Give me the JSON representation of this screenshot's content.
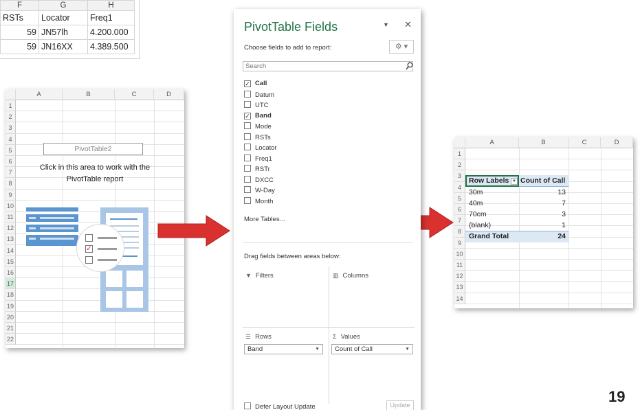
{
  "fragment": {
    "columns": [
      "F",
      "G",
      "H"
    ],
    "header": [
      "RSTs",
      "Locator",
      "Freq1"
    ],
    "rows": [
      [
        "59",
        "JN57lh",
        "4.200.000"
      ],
      [
        "59",
        "JN16XX",
        "4.389.500"
      ]
    ]
  },
  "sheet1": {
    "columns": [
      "A",
      "B",
      "C",
      "D"
    ],
    "rows": [
      "1",
      "2",
      "3",
      "4",
      "5",
      "6",
      "7",
      "8",
      "9",
      "10",
      "11",
      "12",
      "13",
      "14",
      "15",
      "16",
      "17",
      "18",
      "19",
      "20",
      "21",
      "22"
    ],
    "active_row": "17",
    "placeholder_name": "PivotTable2",
    "hint": "Click in this area to work with the PivotTable report"
  },
  "pane": {
    "title": "PivotTable Fields",
    "choose_label": "Choose fields to add to report:",
    "search_placeholder": "Search",
    "fields": [
      {
        "label": "Call",
        "checked": true
      },
      {
        "label": "Datum",
        "checked": false
      },
      {
        "label": "UTC",
        "checked": false
      },
      {
        "label": "Band",
        "checked": true
      },
      {
        "label": "Mode",
        "checked": false
      },
      {
        "label": "RSTs",
        "checked": false
      },
      {
        "label": "Locator",
        "checked": false
      },
      {
        "label": "Freq1",
        "checked": false
      },
      {
        "label": "RSTr",
        "checked": false
      },
      {
        "label": "DXCC",
        "checked": false
      },
      {
        "label": "W-Day",
        "checked": false
      },
      {
        "label": "Month",
        "checked": false
      }
    ],
    "more_tables": "More Tables...",
    "drag_hint": "Drag fields between areas below:",
    "areas": {
      "filters": "Filters",
      "columns": "Columns",
      "rows": "Rows",
      "values": "Values",
      "rows_value": "Band",
      "values_value": "Count of Call"
    },
    "defer_label": "Defer Layout Update",
    "update_label": "Update"
  },
  "sheet2": {
    "columns": [
      "A",
      "B",
      "C",
      "D"
    ],
    "rows": [
      "1",
      "2",
      "3",
      "4",
      "5",
      "6",
      "7",
      "8",
      "9",
      "10",
      "11",
      "12",
      "13",
      "14"
    ],
    "header": [
      "Row Labels",
      "Count of Call"
    ],
    "data": [
      {
        "label": "30m",
        "count": "13"
      },
      {
        "label": "40m",
        "count": "7"
      },
      {
        "label": "70cm",
        "count": "3"
      },
      {
        "label": "(blank)",
        "count": "1"
      }
    ],
    "total_label": "Grand Total",
    "total_count": "24"
  },
  "page_number": "19",
  "colors": {
    "excel_green": "#217346",
    "arrow_red": "#d9312f",
    "pivot_blue": "#5b95cf"
  }
}
